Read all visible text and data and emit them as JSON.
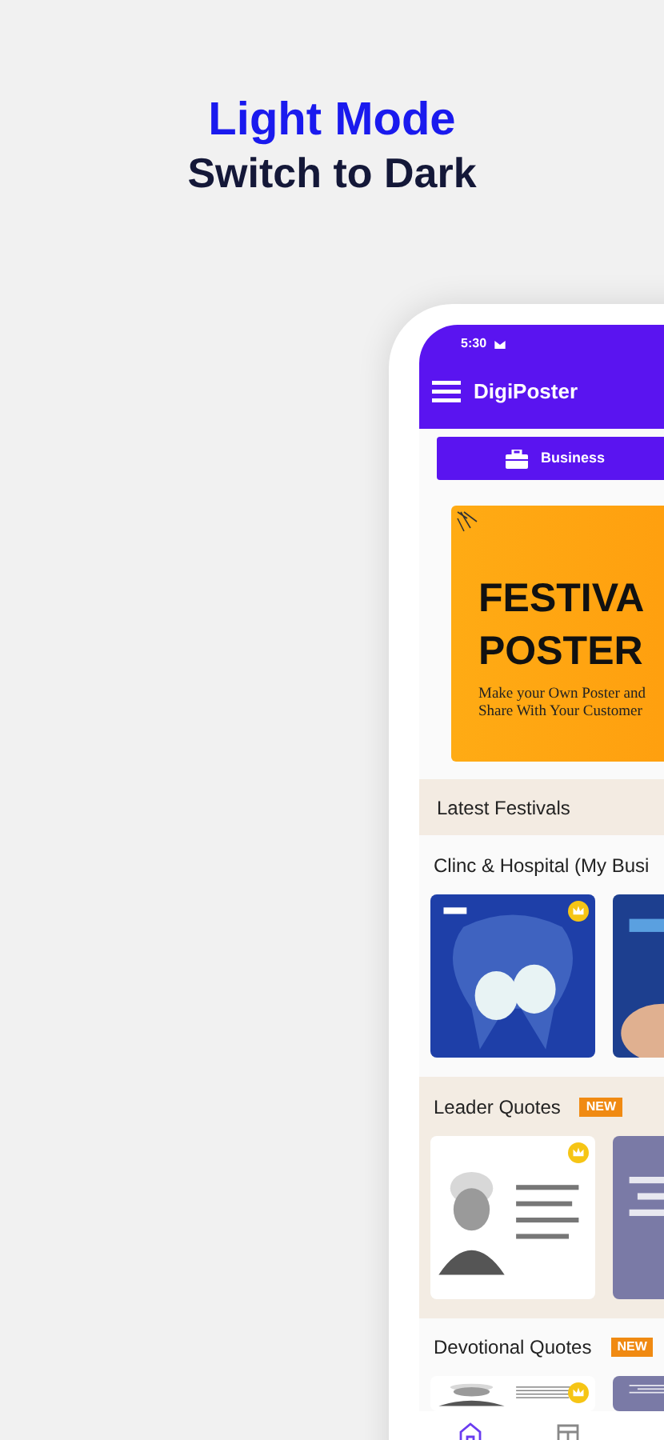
{
  "headline": {
    "title": "Light Mode",
    "subtitle": "Switch to Dark"
  },
  "status_bar": {
    "time": "5:30"
  },
  "app_bar": {
    "title": "DigiPoster"
  },
  "category_button": {
    "label": "Business"
  },
  "banner": {
    "title_line_1": "FESTIVA",
    "title_line_2": "POSTER",
    "subtitle": "Make your Own Poster and Share With Your Customer"
  },
  "sections": [
    {
      "title": "Latest Festivals",
      "kind": "header"
    },
    {
      "title": "Clinc & Hospital (My Busi",
      "kind": "cards",
      "tinted": false,
      "cards": [
        {
          "kind": "picture",
          "premium": true
        },
        {
          "kind": "picture"
        }
      ]
    },
    {
      "title": "Leader Quotes",
      "kind": "cards",
      "tinted": true,
      "badge": "NEW",
      "cards": [
        {
          "kind": "picture",
          "premium": true
        },
        {
          "kind": "picture"
        }
      ]
    },
    {
      "title": "Devotional Quotes",
      "kind": "cards_cut",
      "tinted": false,
      "badge": "NEW",
      "cards": [
        {
          "kind": "picture",
          "premium": true
        },
        {
          "kind": "picture"
        }
      ]
    }
  ],
  "bottom_nav": [
    {
      "kind": "home",
      "selected": true
    },
    {
      "kind": "template",
      "selected": false
    }
  ]
}
